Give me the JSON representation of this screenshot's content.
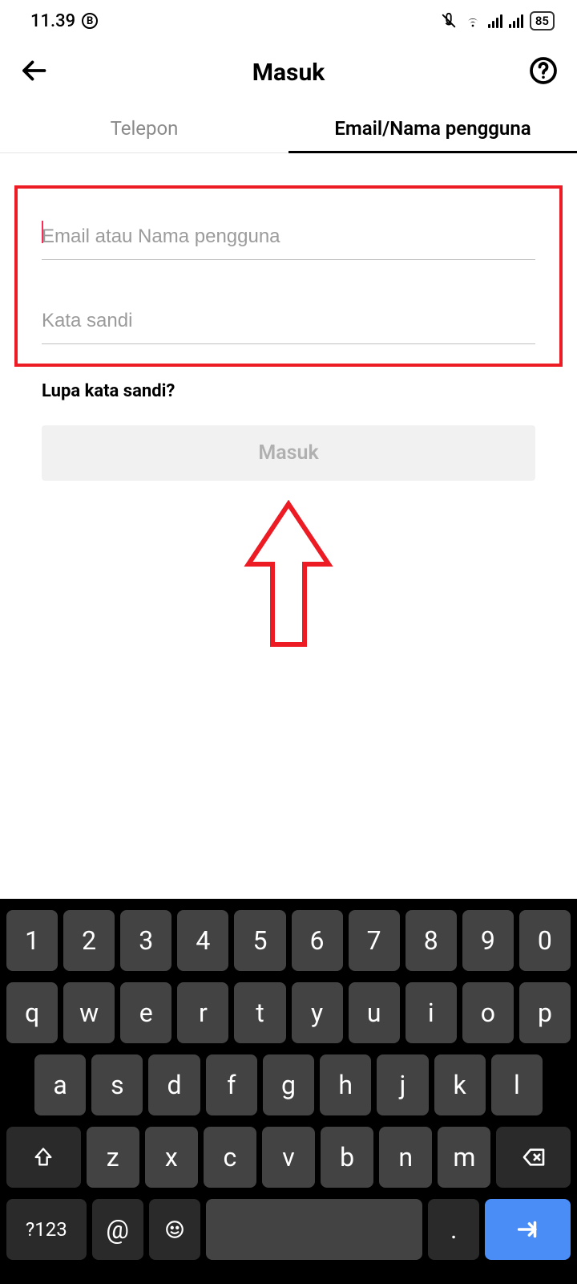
{
  "status": {
    "time": "11.39",
    "battery": "85"
  },
  "header": {
    "title": "Masuk"
  },
  "tabs": {
    "phone": "Telepon",
    "email": "Email/Nama pengguna"
  },
  "form": {
    "email_placeholder": "Email atau Nama pengguna",
    "password_placeholder": "Kata sandi",
    "forgot_label": "Lupa kata sandi?",
    "login_button": "Masuk"
  },
  "keyboard": {
    "row0": [
      "1",
      "2",
      "3",
      "4",
      "5",
      "6",
      "7",
      "8",
      "9",
      "0"
    ],
    "row1": [
      "q",
      "w",
      "e",
      "r",
      "t",
      "y",
      "u",
      "i",
      "o",
      "p"
    ],
    "row2": [
      "a",
      "s",
      "d",
      "f",
      "g",
      "h",
      "j",
      "k",
      "l"
    ],
    "row3": [
      "z",
      "x",
      "c",
      "v",
      "b",
      "n",
      "m"
    ],
    "mode_key": "?123",
    "at_key": "@",
    "dot_key": "."
  }
}
